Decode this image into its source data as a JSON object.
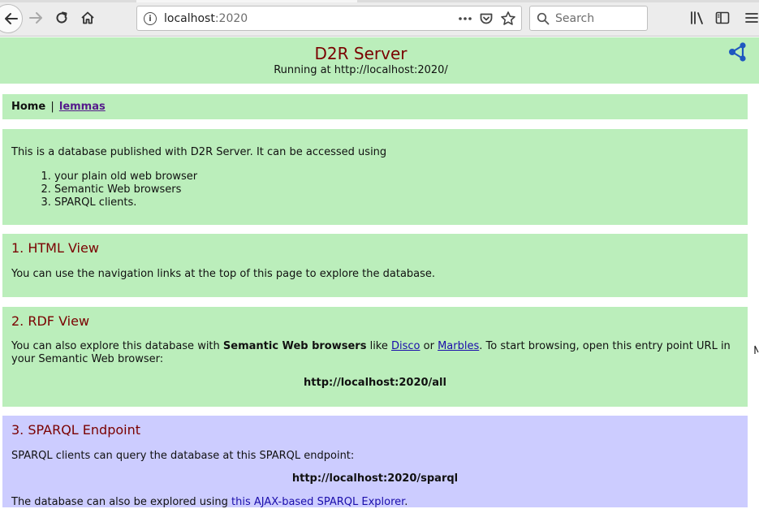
{
  "browser": {
    "url_host": "localhost",
    "url_port": ":2020",
    "search_placeholder": "Search",
    "icons": [
      "back-icon",
      "forward-icon",
      "reload-icon",
      "home-icon",
      "site-info-icon",
      "page-actions-icon",
      "pocket-icon",
      "bookmark-star-icon",
      "search-icon",
      "library-icon",
      "sidebar-icon",
      "menu-icon"
    ]
  },
  "header": {
    "title": "D2R Server",
    "subtitle": "Running at http://localhost:2020/",
    "icon": "share-graph-icon"
  },
  "nav": {
    "home": "Home",
    "separator": "|",
    "lemmas": "lemmas"
  },
  "intro": {
    "text": "This is a database published with D2R Server. It can be accessed using",
    "items": [
      "your plain old web browser",
      "Semantic Web browsers",
      "SPARQL clients."
    ]
  },
  "html_view": {
    "title": "1. HTML View",
    "text": "You can use the navigation links at the top of this page to explore the database."
  },
  "rdf_view": {
    "title": "2. RDF View",
    "text_1": "You can also explore this database with ",
    "bold": "Semantic Web browsers",
    "text_2": " like ",
    "link_1": "Disco",
    "text_3": " or ",
    "link_2": "Marbles",
    "text_4": ". To start browsing, open this entry point URL in your Semantic Web browser:",
    "entry_url": "http://localhost:2020/all"
  },
  "sparql": {
    "title": "3. SPARQL Endpoint",
    "text": "SPARQL clients can query the database at this SPARQL endpoint:",
    "endpoint": "http://localhost:2020/sparql",
    "text_2": "The database can also be explored using ",
    "link": "this AJAX-based SPARQL Explorer",
    "text_3": "."
  },
  "colors": {
    "green_box": "#bbeebb",
    "blue_box": "#ccccff",
    "heading": "#7a0000",
    "link": "#1a0dab",
    "visited": "#551a8b"
  }
}
